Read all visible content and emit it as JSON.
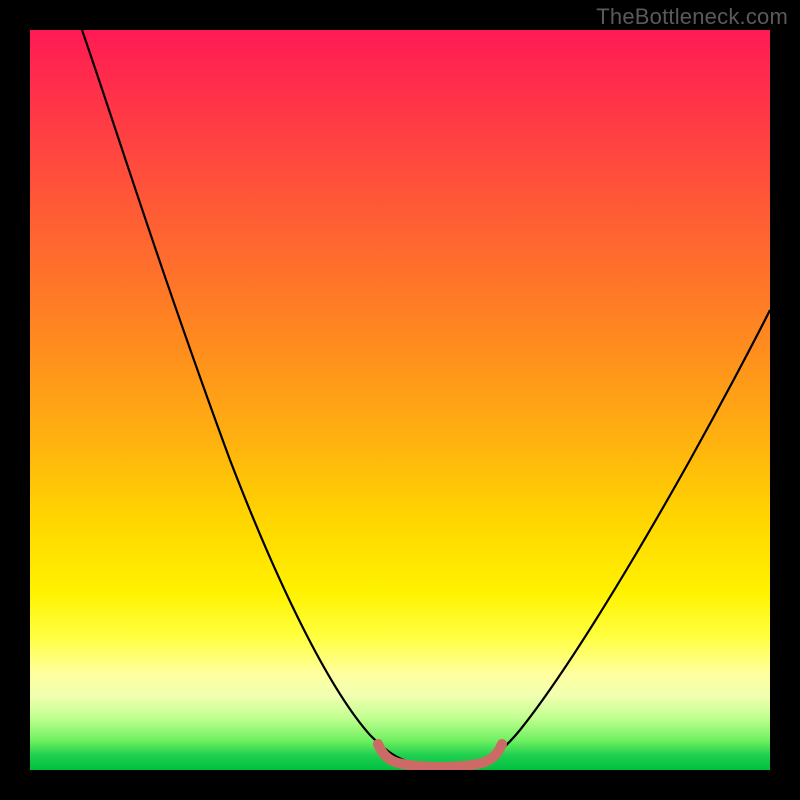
{
  "watermark": "TheBottleneck.com",
  "chart_data": {
    "type": "line",
    "title": "",
    "xlabel": "",
    "ylabel": "",
    "xlim": [
      0,
      100
    ],
    "ylim": [
      0,
      100
    ],
    "series": [
      {
        "name": "bottleneck-curve",
        "x": [
          7,
          10,
          15,
          20,
          25,
          30,
          35,
          40,
          44,
          47,
          49,
          51,
          53,
          55,
          57,
          59,
          62,
          66,
          72,
          80,
          90,
          100
        ],
        "values": [
          100,
          93,
          82,
          71,
          60,
          49,
          38,
          27,
          17,
          10,
          5,
          2,
          1,
          1,
          1,
          2,
          5,
          12,
          23,
          38,
          54,
          67
        ]
      },
      {
        "name": "optimal-flat-marker",
        "x": [
          47,
          49,
          51,
          53,
          55,
          57,
          59,
          61
        ],
        "values": [
          3,
          2,
          1.2,
          1,
          1,
          1.2,
          2,
          3
        ]
      }
    ],
    "colors": {
      "curve": "#000000",
      "marker": "#cc6b66"
    }
  }
}
